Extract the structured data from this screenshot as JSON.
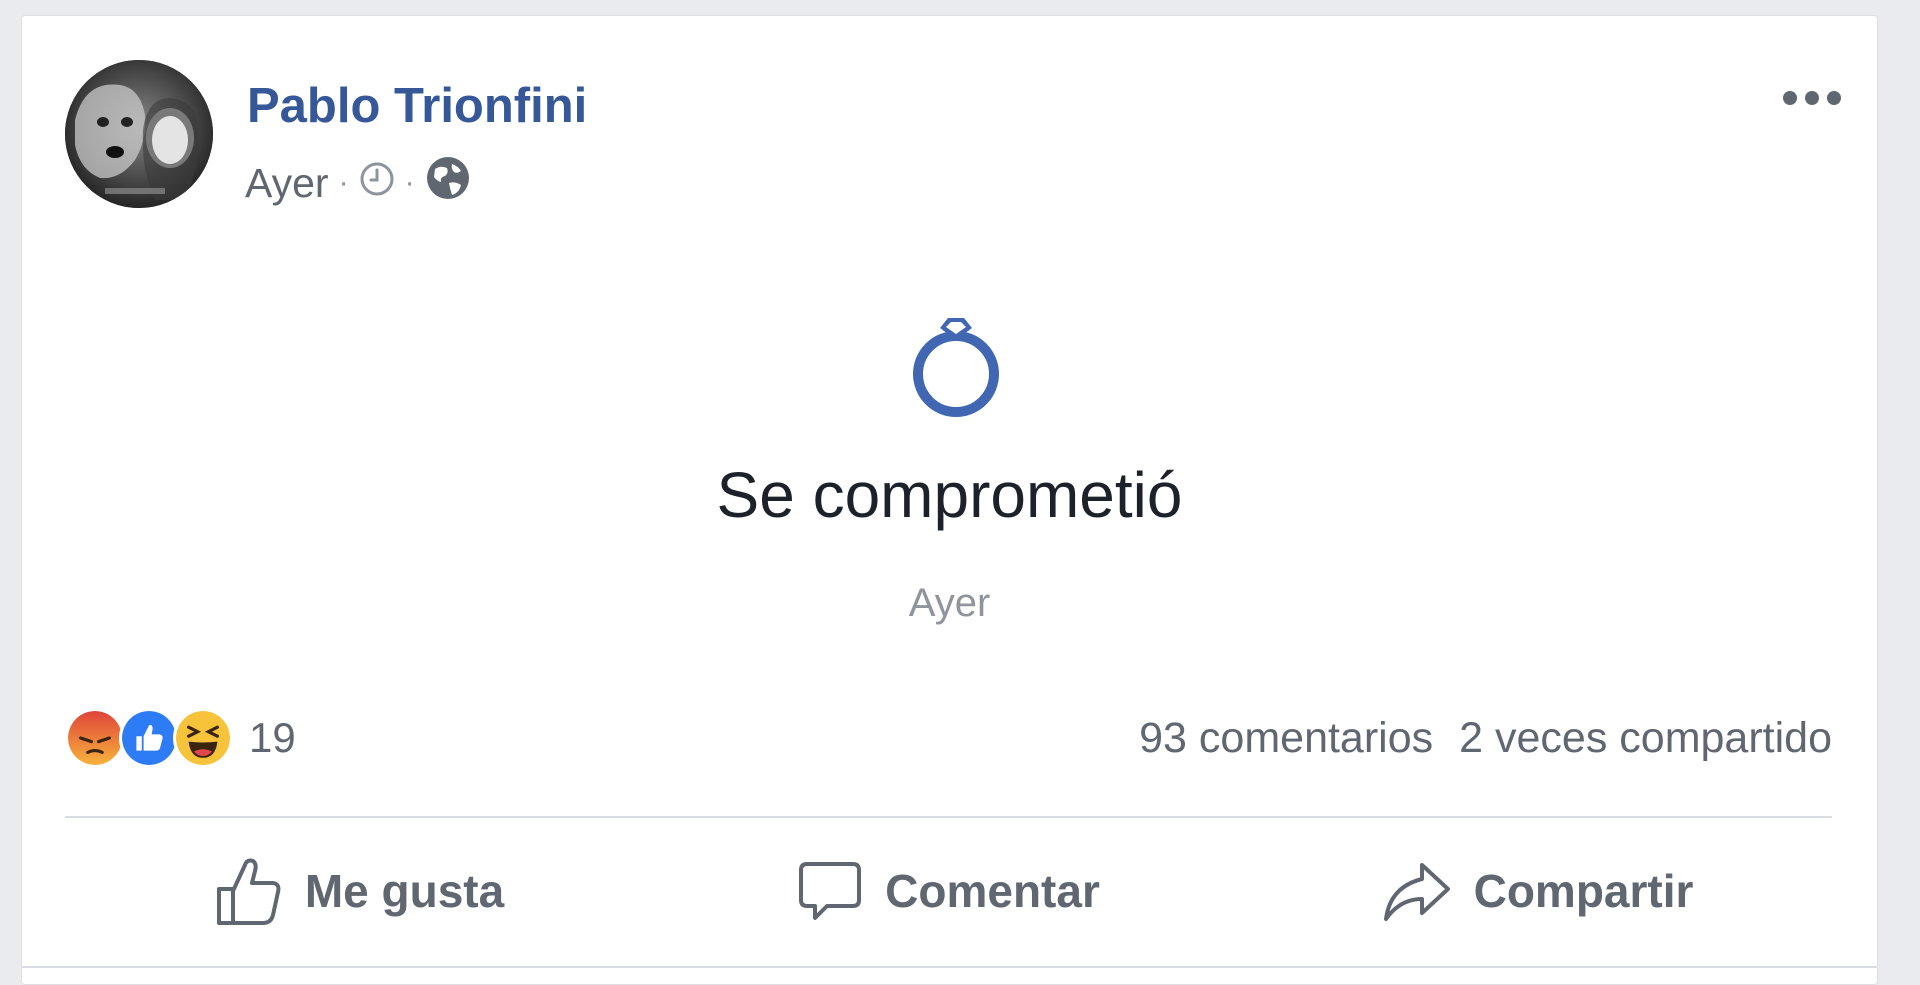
{
  "post": {
    "author": "Pablo Trionfini",
    "timestamp": "Ayer",
    "timestamp_icon": "clock-icon",
    "privacy_icon": "globe-icon",
    "more_icon": "more-dots-icon"
  },
  "life_event": {
    "icon": "ring-icon",
    "title": "Se comprometió",
    "date": "Ayer",
    "accent_color": "#4267b2"
  },
  "stats": {
    "reactions": [
      "angry-reaction",
      "like-reaction",
      "haha-reaction"
    ],
    "reaction_count": "19",
    "comments": "93 comentarios",
    "shares": "2 veces compartido"
  },
  "actions": {
    "like_label": "Me gusta",
    "comment_label": "Comentar",
    "share_label": "Compartir"
  },
  "colors": {
    "author_link": "#365899",
    "secondary_text": "#616770",
    "primary_text": "#1d2129",
    "background": "#e9ebee",
    "card": "#ffffff"
  }
}
